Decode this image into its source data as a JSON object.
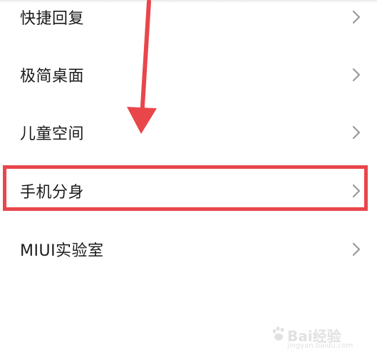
{
  "settings_list": {
    "items": [
      {
        "label": "快捷回复"
      },
      {
        "label": "极简桌面"
      },
      {
        "label": "儿童空间"
      },
      {
        "label": "手机分身"
      },
      {
        "label": "MIUI实验室"
      }
    ],
    "highlighted_index": 3
  },
  "annotation": {
    "highlight_color": "#e8464b",
    "arrow_color": "#e8464b"
  },
  "watermark": {
    "text": "Bai经验",
    "url": "jingyan.baidu.com"
  },
  "colors": {
    "text": "#1a1a1a",
    "chevron": "#9a9a9a",
    "background": "#ffffff"
  }
}
